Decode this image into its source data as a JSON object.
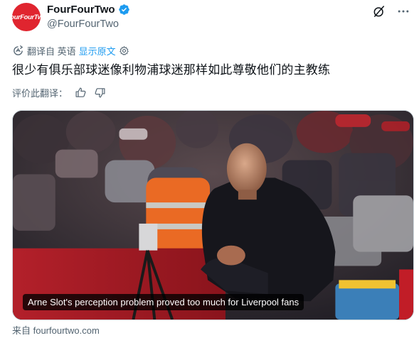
{
  "author": {
    "avatar_text": "FourFourTwo",
    "name": "FourFourTwo",
    "handle": "@FourFourTwo",
    "verified": true,
    "brand_color": "#e0252f"
  },
  "translation": {
    "label": "翻译自 英语",
    "show_original": "显示原文",
    "icons": [
      "translate-icon",
      "gear-icon"
    ]
  },
  "tweet": {
    "text": "很少有俱乐部球迷像利物浦球迷那样如此尊敬他们的主教练"
  },
  "rating": {
    "label": "评价此翻译：",
    "icons": [
      "thumbs-up-icon",
      "thumbs-down-icon"
    ]
  },
  "media": {
    "caption": "Arne Slot's perception problem proved too much for Liverpool fans"
  },
  "card_source": {
    "text": "来自 fourfourtwo.com"
  },
  "colors": {
    "link": "#1d9bf0",
    "muted": "#536471",
    "text": "#0f1419"
  }
}
